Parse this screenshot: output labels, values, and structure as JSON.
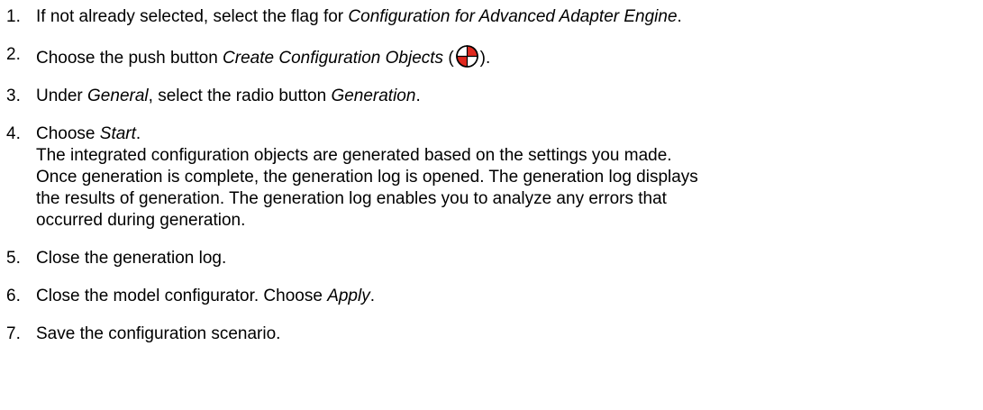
{
  "steps": [
    {
      "num": "1.",
      "pre": "If not already selected, select the flag for ",
      "em": "Configuration for Advanced Adapter Engine",
      "post": "."
    },
    {
      "num": "2.",
      "pre": "Choose the push button ",
      "em": "Create Configuration Objects",
      "mid": " (",
      "icon": "create-configuration-objects-icon",
      "post": ")."
    },
    {
      "num": "3.",
      "pre": "Under ",
      "em1": "General",
      "mid": ", select the radio button ",
      "em2": "Generation",
      "post": "."
    },
    {
      "num": "4.",
      "pre": "Choose ",
      "em": "Start",
      "post": ".",
      "note_lines": [
        "The integrated configuration objects are generated based on the settings you made.",
        "Once generation is complete, the generation log is opened. The generation log displays",
        "the results of generation. The generation log enables you to analyze any errors that",
        "occurred during generation."
      ]
    },
    {
      "num": "5.",
      "text": "Close the generation log."
    },
    {
      "num": "6.",
      "pre": "Close the model configurator. Choose ",
      "em": "Apply",
      "post": "."
    },
    {
      "num": "7.",
      "text": "Save the configuration scenario."
    }
  ],
  "colors": {
    "icon_red": "#e0281e",
    "icon_outline": "#000000"
  }
}
